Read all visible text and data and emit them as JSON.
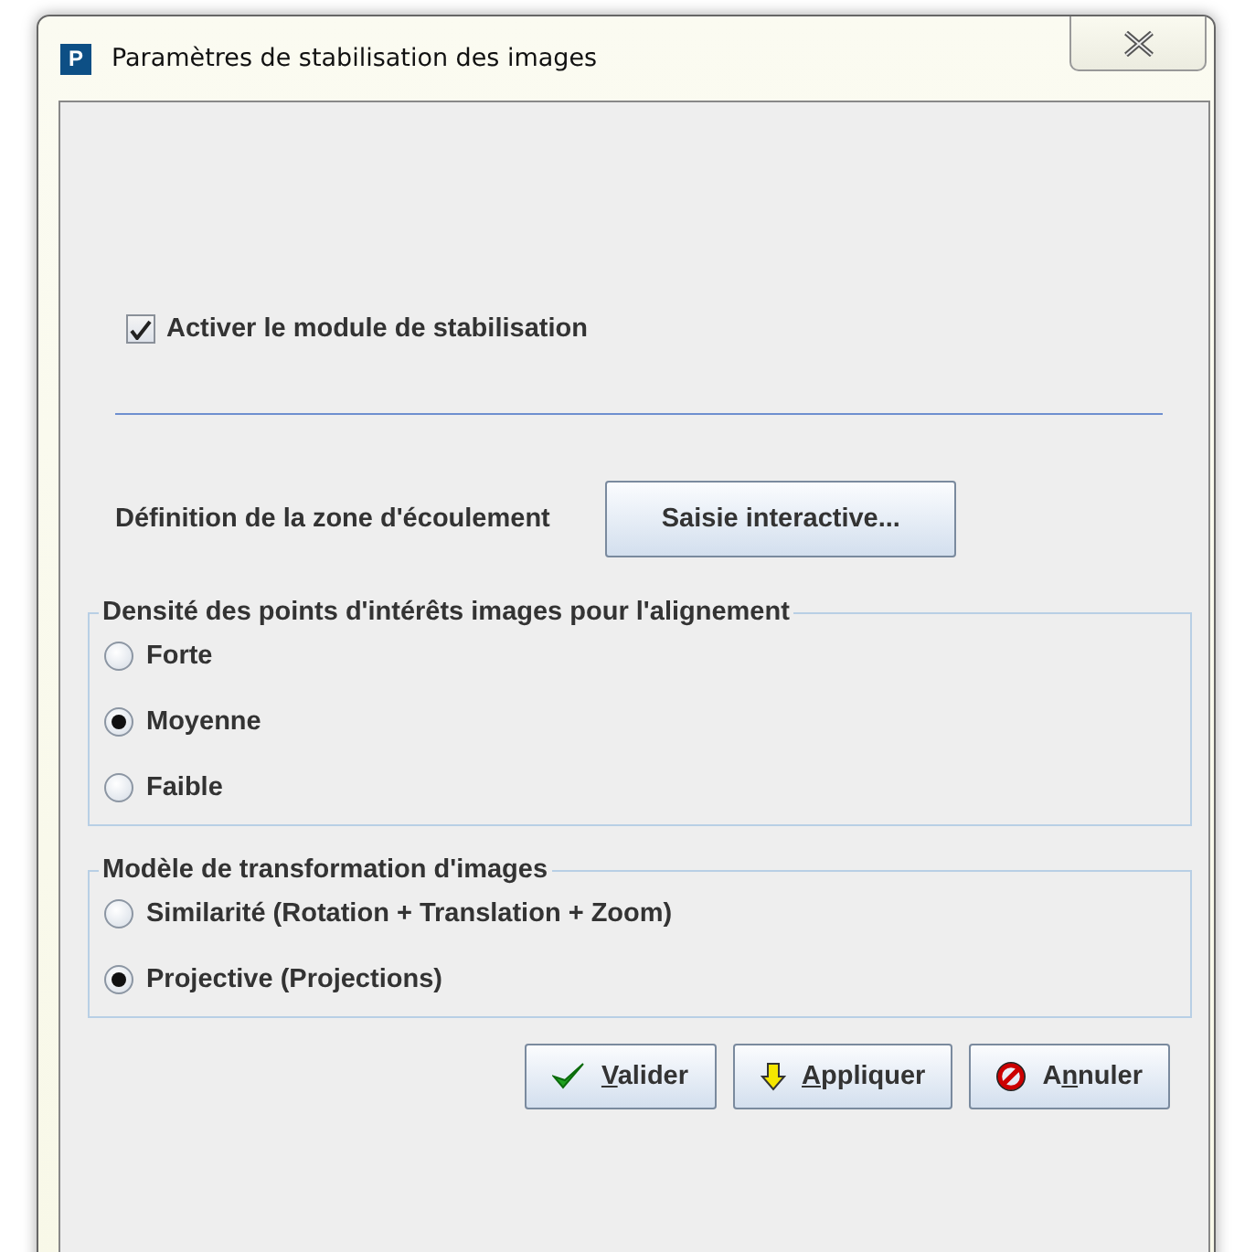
{
  "window": {
    "title": "Paramètres de stabilisation des images",
    "app_icon": "P"
  },
  "enable_checkbox": {
    "label": "Activer le module de stabilisation",
    "checked": true
  },
  "zone_row": {
    "label": "Définition de la zone d'écoulement",
    "button": "Saisie interactive..."
  },
  "groups": [
    {
      "title": "Densité des points d'intérêts images pour l'alignement",
      "options": [
        {
          "label": "Forte",
          "selected": false
        },
        {
          "label": "Moyenne",
          "selected": true
        },
        {
          "label": "Faible",
          "selected": false
        }
      ]
    },
    {
      "title": "Modèle de transformation d'images",
      "options": [
        {
          "label": "Similarité (Rotation + Translation + Zoom)",
          "selected": false
        },
        {
          "label": "Projective (Projections)",
          "selected": true
        }
      ]
    }
  ],
  "buttons": [
    {
      "kind": "ok",
      "label_parts": [
        {
          "text": "V",
          "underlined": true
        },
        {
          "text": "alider",
          "underlined": false
        }
      ]
    },
    {
      "kind": "apply",
      "label_parts": [
        {
          "text": "A",
          "underlined": true
        },
        {
          "text": "ppliquer",
          "underlined": false
        }
      ]
    },
    {
      "kind": "cancel",
      "label_parts": [
        {
          "text": "A",
          "underlined": false
        },
        {
          "text": "n",
          "underlined": true
        },
        {
          "text": "nuler",
          "underlined": false
        }
      ]
    }
  ]
}
